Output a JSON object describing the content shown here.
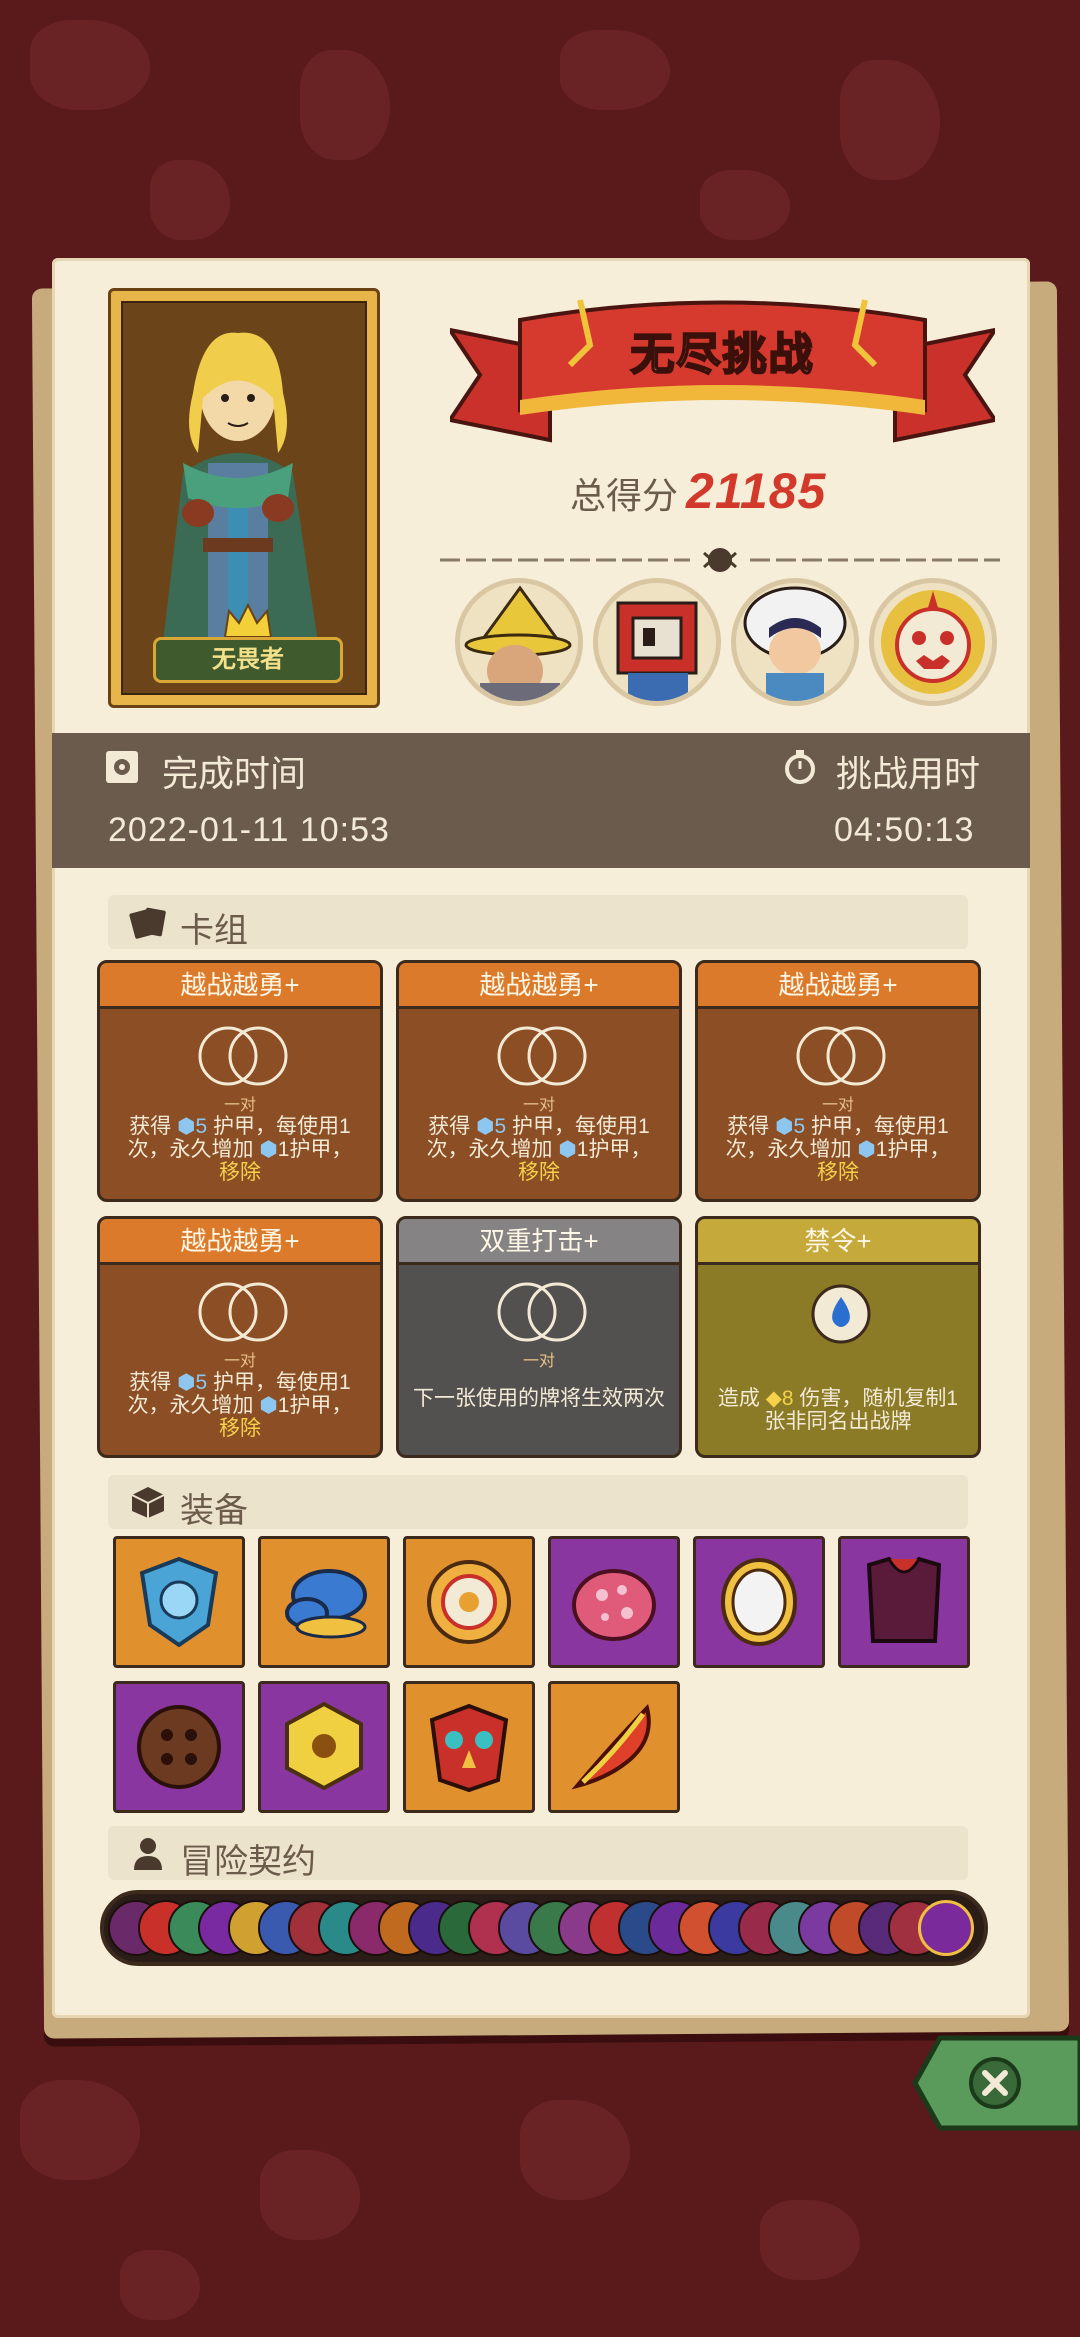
{
  "header": {
    "title": "无尽挑战",
    "score_label": "总得分",
    "score_value": "21185"
  },
  "hero": {
    "name": "无畏者"
  },
  "time": {
    "complete_label": "完成时间",
    "complete_value": "2022-01-11  10:53",
    "duration_label": "挑战用时",
    "duration_value": "04:50:13"
  },
  "deck": {
    "title": "卡组",
    "cards": [
      {
        "name": "越战越勇+",
        "sub": "一对",
        "desc_a": "获得 ",
        "num1": "5",
        "desc_b": " 护甲，每使用1次，永久增加 ",
        "num2": "1",
        "desc_c": "护甲，",
        "desc_d": "移除",
        "color": "orange"
      },
      {
        "name": "越战越勇+",
        "sub": "一对",
        "desc_a": "获得 ",
        "num1": "5",
        "desc_b": " 护甲，每使用1次，永久增加 ",
        "num2": "1",
        "desc_c": "护甲，",
        "desc_d": "移除",
        "color": "orange"
      },
      {
        "name": "越战越勇+",
        "sub": "一对",
        "desc_a": "获得 ",
        "num1": "5",
        "desc_b": " 护甲，每使用1次，永久增加 ",
        "num2": "1",
        "desc_c": "护甲，",
        "desc_d": "移除",
        "color": "orange"
      },
      {
        "name": "越战越勇+",
        "sub": "一对",
        "desc_a": "获得 ",
        "num1": "5",
        "desc_b": " 护甲，每使用1次，永久增加 ",
        "num2": "1",
        "desc_c": "护甲，",
        "desc_d": "移除",
        "color": "orange"
      },
      {
        "name": "双重打击+",
        "sub": "一对",
        "desc": "下一张使用的牌将生效两次",
        "color": "gray"
      },
      {
        "name": "禁令+",
        "desc_a": "造成 ",
        "num1": "8",
        "desc_b": " 伤害，随机复制1张非同名出战牌",
        "color": "gold"
      }
    ]
  },
  "equipment": {
    "title": "装备",
    "items": [
      {
        "icon": "blue-shield-icon",
        "rarity": "orange"
      },
      {
        "icon": "blue-mushroom-icon",
        "rarity": "orange"
      },
      {
        "icon": "gold-ring-icon",
        "rarity": "orange"
      },
      {
        "icon": "pink-shell-icon",
        "rarity": "purple"
      },
      {
        "icon": "golden-mirror-icon",
        "rarity": "purple"
      },
      {
        "icon": "dark-armor-icon",
        "rarity": "purple"
      },
      {
        "icon": "wooden-button-icon",
        "rarity": "purple"
      },
      {
        "icon": "golden-box-icon",
        "rarity": "purple"
      },
      {
        "icon": "jeweled-mask-icon",
        "rarity": "orange"
      },
      {
        "icon": "fire-feather-icon",
        "rarity": "orange"
      }
    ]
  },
  "contracts": {
    "title": "冒险契约"
  },
  "colors": {
    "background": "#5a1a1c",
    "panel": "#f6eed9",
    "score": "#d2392b",
    "time_bar": "#6b5b4c"
  }
}
